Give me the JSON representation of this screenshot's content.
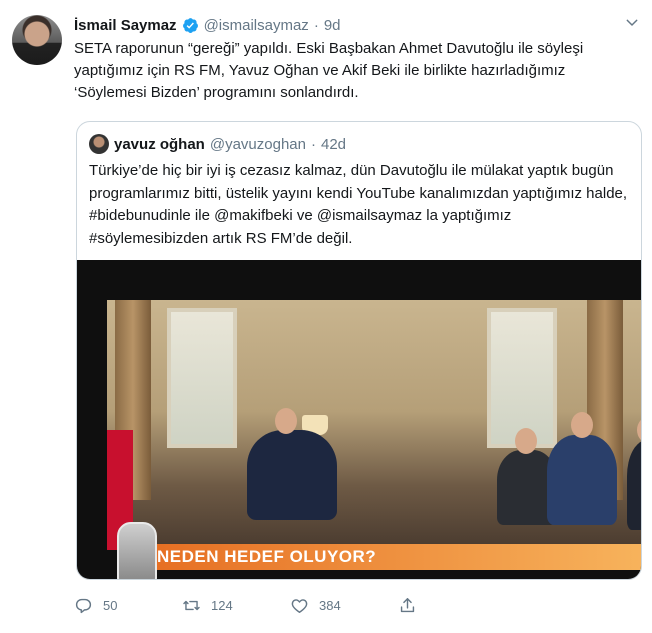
{
  "tweet": {
    "display_name": "İsmail Saymaz",
    "handle": "@ismailsaymaz",
    "separator": "·",
    "time": "9d",
    "text": "SETA raporunun “gereği” yapıldı. Eski Başbakan Ahmet Davutoğlu ile söyleşi yaptığımız için RS FM, Yavuz Oğhan ve Akif Beki ile birlikte hazırladığımız ‘Söylemesi Bizden’ programını sonlandırdı."
  },
  "quoted": {
    "display_name": "yavuz oğhan",
    "handle": "@yavuzoghan",
    "separator": "·",
    "time": "42d",
    "text": "Türkiye’de hiç bir iyi iş cezasız kalmaz, dün Davutoğlu ile mülakat yaptık bugün programlarımız bitti, üstelik yayını kendi YouTube kanalımızdan yaptığımız halde, #bidebunudinle ile @makifbeki ve @ismailsaymaz la yaptığımız #söylemesibizden artık RS FM’de değil.",
    "media_caption": "NEDEN HEDEF OLUYOR?"
  },
  "actions": {
    "reply_count": "50",
    "retweet_count": "124",
    "like_count": "384"
  },
  "colors": {
    "verified": "#1da1f2",
    "secondary_text": "#657786",
    "border": "#ccd6dd",
    "banner": "#e56a1f"
  },
  "icons": {
    "reply": "reply-icon",
    "retweet": "retweet-icon",
    "like": "like-icon",
    "share": "share-icon",
    "menu": "chevron-down-icon"
  }
}
